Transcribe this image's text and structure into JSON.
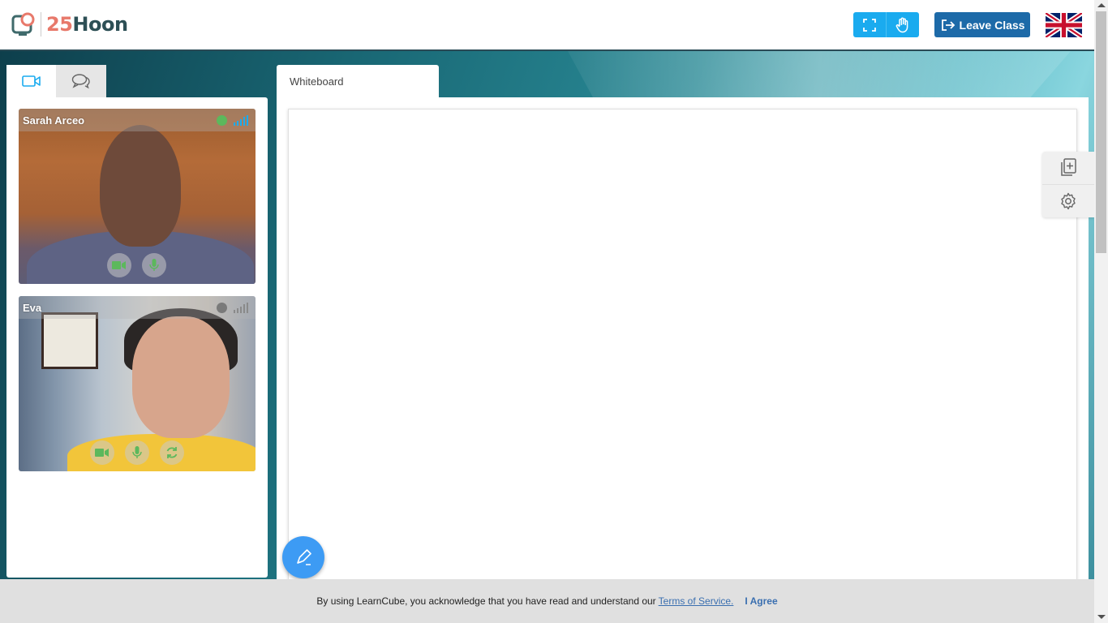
{
  "header": {
    "logo_number": "25",
    "logo_word": "Hoon",
    "fullscreen_icon": "fullscreen-icon",
    "raise_hand_icon": "hand-icon",
    "leave_label": "Leave Class",
    "language_flag": "uk-flag-icon"
  },
  "left_tabs": [
    {
      "icon": "video-camera-icon",
      "active": true
    },
    {
      "icon": "chat-icon",
      "active": false
    }
  ],
  "participants": [
    {
      "name": "Sarah Arceo",
      "status_color": "#5cb85c",
      "signal_color": "#1aabef",
      "controls": [
        "camera-icon",
        "microphone-icon"
      ]
    },
    {
      "name": "Eva",
      "status_color": "#7a7a7a",
      "signal_color": "#9a9a9a",
      "controls": [
        "camera-icon",
        "microphone-icon",
        "refresh-icon"
      ]
    }
  ],
  "whiteboard": {
    "tab_label": "Whiteboard",
    "side_tools": [
      "add-page-icon",
      "settings-icon"
    ],
    "pen_icon": "pen-icon"
  },
  "cookie": {
    "text": "By using LearnCube, you acknowledge that you have read and understand our",
    "link": "Terms of Service.",
    "agree": "I Agree"
  },
  "colors": {
    "accent": "#1aabef",
    "leave": "#1d6aa8",
    "pen": "#3d9bf4"
  }
}
